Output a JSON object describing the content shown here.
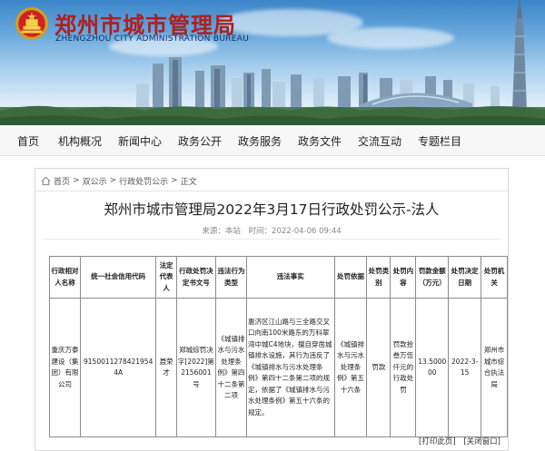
{
  "header": {
    "title_cn": "郑州市城市管理局",
    "title_en": "ZHENGZHOU CITY ADMINISTRATION BUREAU"
  },
  "nav": {
    "items": [
      "首页",
      "机构概况",
      "新闻中心",
      "政务公开",
      "政务服务",
      "政务文件",
      "交流互动",
      "专题栏目"
    ]
  },
  "breadcrumb": {
    "items": [
      "首页",
      "双公示",
      "行政处罚公示",
      "正文"
    ],
    "separator": ">"
  },
  "article": {
    "title": "郑州市城市管理局2022年3月17日行政处罚公示-法人",
    "source_label": "来源：本站",
    "time_label": "时间：2022-04-06 09:44"
  },
  "table": {
    "headers": [
      "行政相对人名称",
      "统一社会信用代码",
      "法定代表人",
      "行政处罚决定书文号",
      "违法行为类型",
      "违法事实",
      "处罚依据",
      "处罚类别",
      "处罚内容",
      "罚款金额（万元）",
      "处罚决定日期",
      "处罚机关"
    ],
    "rows": [
      [
        "重庆万泰建设（集团）有限公司",
        "91500112784219544A",
        "聂荣才",
        "郑城综罚决字[2022]第2156001号",
        "《城镇排水与污水处理条例》第四十二条第二项",
        "惠济区江山路与三全路交叉口向南100米路东的万科翠湾中城C4地块，擅自穿凿城镇排水设施，其行为违反了《城镇排水与污水处理条例》第四十二条第二项的规定，依据了《城镇排水与污水处理条例》第五十六条的规定。",
        "《城镇排水与污水处理条例》第五十六条",
        "罚款",
        "罚款拾叁万伍仟元的行政处罚",
        "13.500000",
        "2022-3-15",
        "郑州市城市综合执法局"
      ]
    ]
  },
  "footer": {
    "print_label": "[打印此页]",
    "close_label": "[关闭窗口]"
  },
  "colors": {
    "title_red": "#b01e1e",
    "sky_blue": "#3c86c9"
  },
  "icons": {
    "home": "home-icon",
    "logo": "emblem-logo"
  }
}
